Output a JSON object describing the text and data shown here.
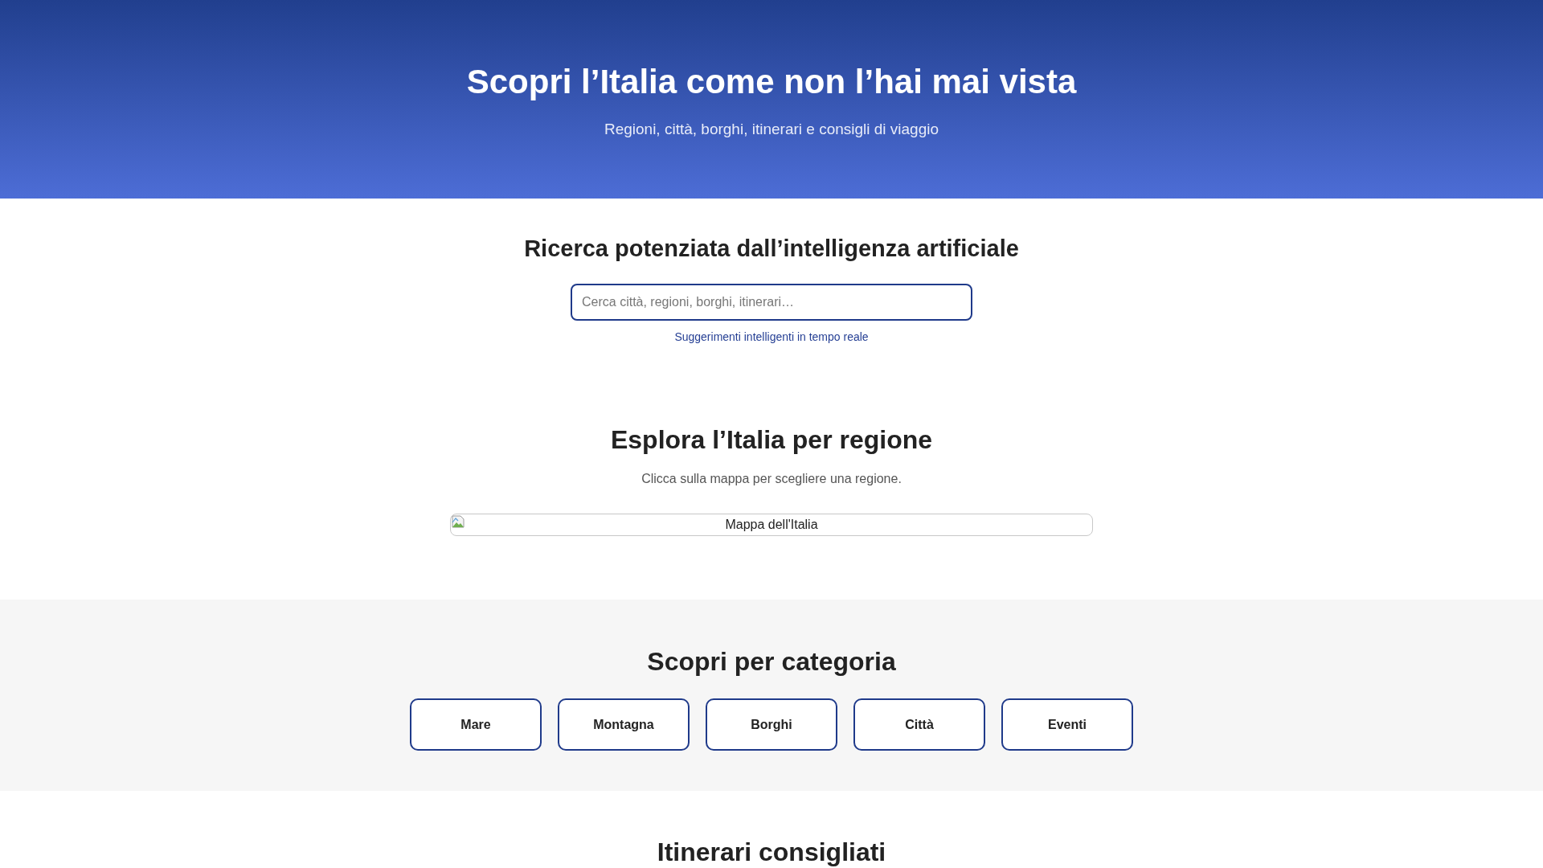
{
  "hero": {
    "title": "Scopri l’Italia come non l’hai mai vista",
    "subtitle": "Regioni, città, borghi, itinerari e consigli di viaggio"
  },
  "ai_search": {
    "heading": "Ricerca potenziata dall’intelligenza artificiale",
    "search": {
      "placeholder": "Cerca città, regioni, borghi, itinerari…"
    },
    "hint": "Suggerimenti intelligenti in tempo reale"
  },
  "regions": {
    "heading": "Esplora l’Italia per regione",
    "subtitle": "Clicca sulla mappa per scegliere una regione.",
    "map": {
      "alt_text": "Mappa dell'Italia"
    }
  },
  "categories": {
    "heading": "Scopri per categoria",
    "items": [
      "Mare",
      "Montagna",
      "Borghi",
      "Città",
      "Eventi"
    ]
  },
  "itineraries": {
    "heading": "Itinerari consigliati"
  }
}
